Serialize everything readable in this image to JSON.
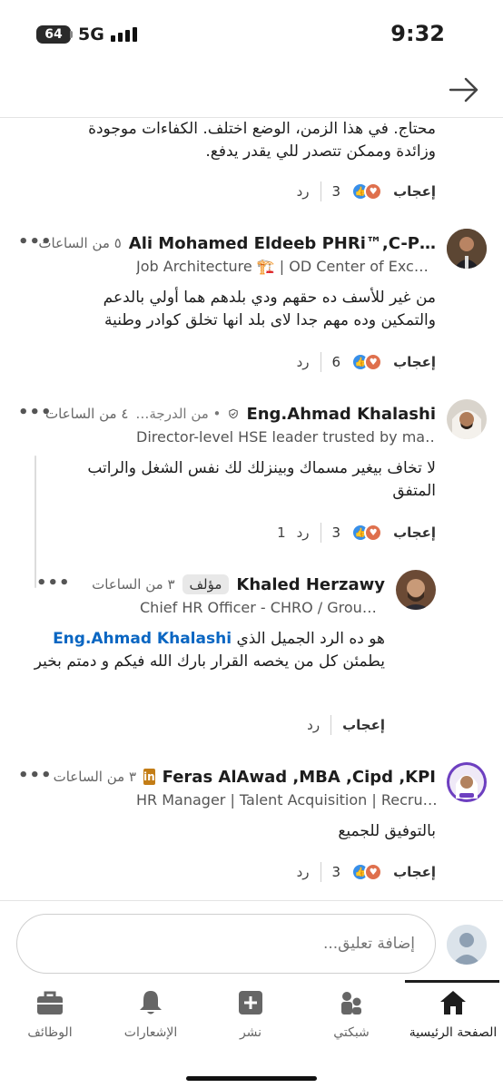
{
  "status_bar": {
    "battery": "64",
    "network": "5G",
    "time": "9:32"
  },
  "comments": [
    {
      "body": "محتاج. في هذا الزمن، الوضع اختلف. الكفاءات موجودة وزائدة وممكن تتصدر للي يقدر يدفع.",
      "like_label": "إعجاب",
      "reaction_count": "3",
      "reply_label": "رد"
    },
    {
      "name": "Ali Mohamed Eldeeb PHRi™,C-P…",
      "time": "٥ من الساعات",
      "headline": "Job Architecture 🏗️ | OD Center of Exc…",
      "body": "من غير للأسف ده حقهم ودي بلدهم هما أولي بالدعم والتمكين وده مهم جدا لاى بلد انها تخلق كوادر وطنية",
      "like_label": "إعجاب",
      "reaction_count": "6",
      "reply_label": "رد"
    },
    {
      "name": "Eng.Ahmad Khalashi",
      "degree": "• من الدرجة…",
      "time": "٤ من الساعات",
      "headline": "Director-level HSE leader trusted by ma…",
      "body": "لا تخاف بيغير مسماك وبينزلك لك نفس الشغل والراتب المتفق",
      "like_label": "إعجاب",
      "reaction_count": "3",
      "reply_label": "رد",
      "reply_count": "1"
    },
    {
      "name": "Khaled Herzawy",
      "author_badge": "مؤلف",
      "time": "٣ من الساعات",
      "headline": "Chief HR Officer - CHRO / Grou…",
      "mention": "Eng.Ahmad Khalashi",
      "body_line1": "هو ده الرد الجميل الذي",
      "body_rest": "يطمئن كل من يخصه القرار بارك الله فيكم   و دمتم بخير",
      "like_label": "إعجاب",
      "reply_label": "رد"
    },
    {
      "name": "Feras AlAwad ,MBA ,Cipd ,KPI",
      "time": "٣ من الساعات",
      "headline": "HR Manager | Talent Acquisition | Recru…",
      "body": "بالتوفيق للجميع",
      "like_label": "إعجاب",
      "reaction_count": "3",
      "reply_label": "رد"
    }
  ],
  "composer": {
    "placeholder": "إضافة تعليق..."
  },
  "nav": [
    {
      "label": "الصفحة الرئيسية",
      "icon": "home-icon",
      "active": true
    },
    {
      "label": "شبكتي",
      "icon": "network-icon"
    },
    {
      "label": "نشر",
      "icon": "post-icon"
    },
    {
      "label": "الإشعارات",
      "icon": "bell-icon"
    },
    {
      "label": "الوظائف",
      "icon": "briefcase-icon"
    }
  ],
  "colors": {
    "accent": "#0a66c2",
    "heart": "#df704d",
    "like": "#378fe9"
  }
}
